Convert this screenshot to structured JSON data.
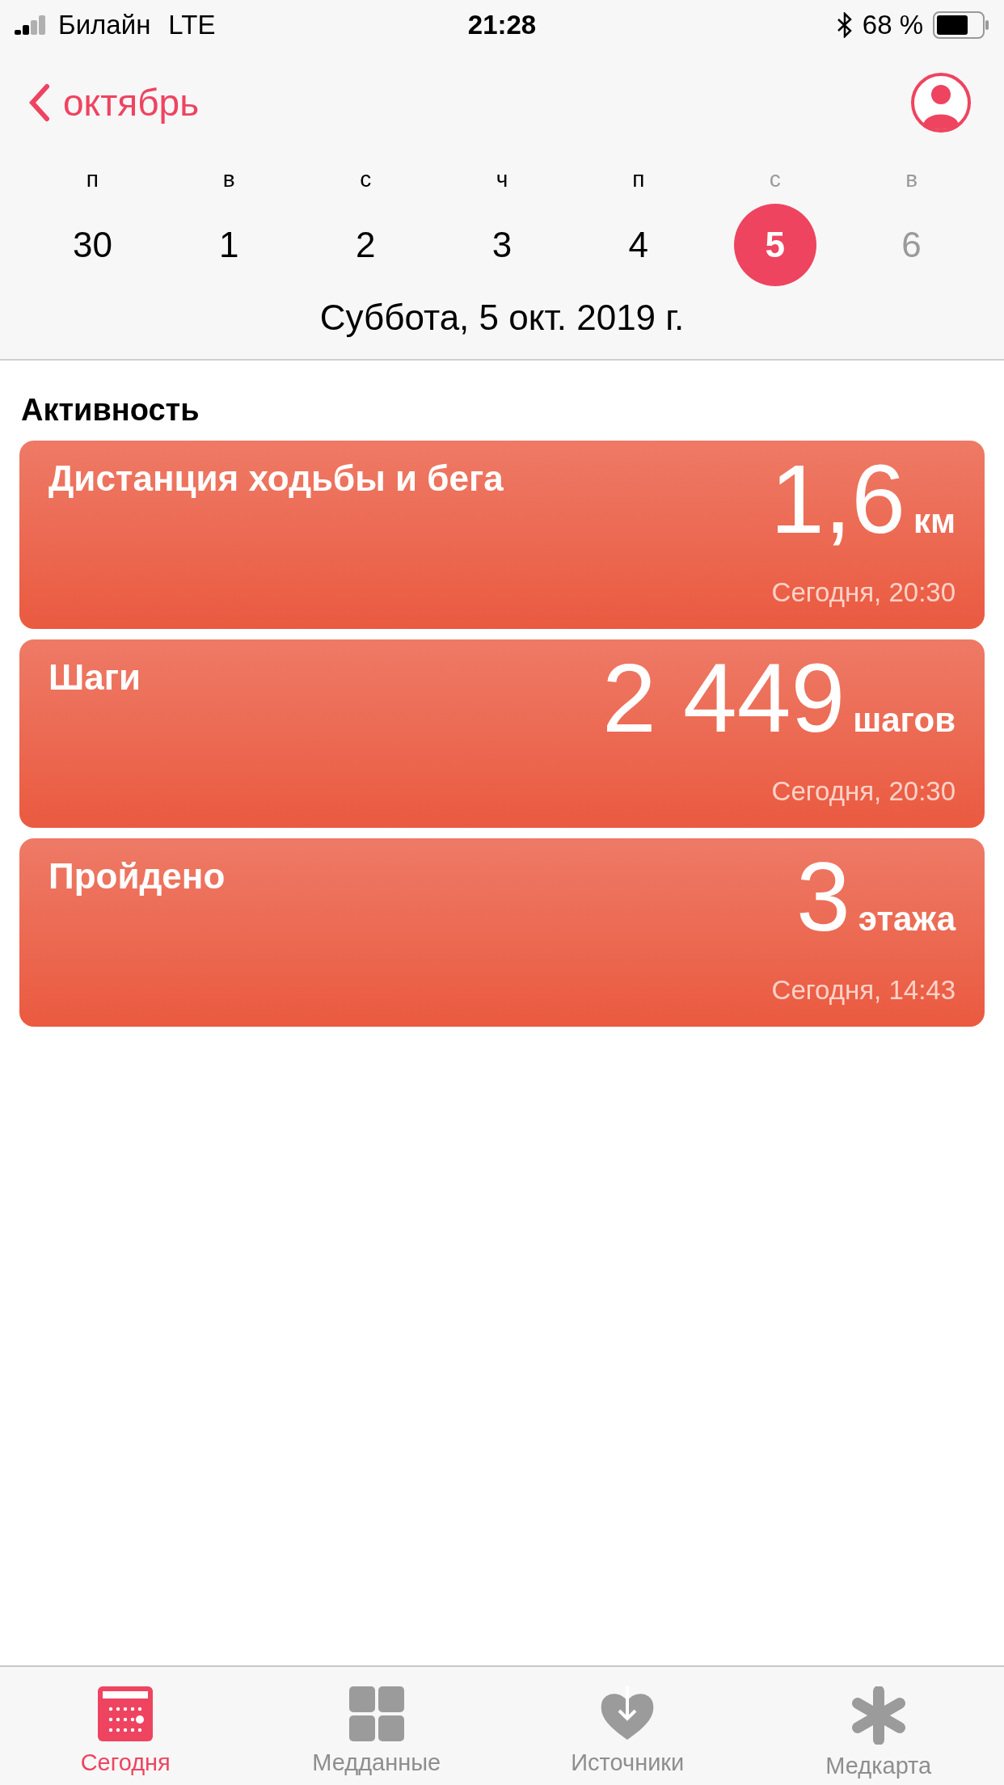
{
  "status_bar": {
    "carrier": "Билайн",
    "network": "LTE",
    "time": "21:28",
    "battery": "68 %"
  },
  "nav": {
    "back_label": "октябрь"
  },
  "week": [
    {
      "weekday": "п",
      "date": "30",
      "weekend": false,
      "future": false,
      "selected": false
    },
    {
      "weekday": "в",
      "date": "1",
      "weekend": false,
      "future": false,
      "selected": false
    },
    {
      "weekday": "с",
      "date": "2",
      "weekend": false,
      "future": false,
      "selected": false
    },
    {
      "weekday": "ч",
      "date": "3",
      "weekend": false,
      "future": false,
      "selected": false
    },
    {
      "weekday": "п",
      "date": "4",
      "weekend": false,
      "future": false,
      "selected": false
    },
    {
      "weekday": "с",
      "date": "5",
      "weekend": true,
      "future": false,
      "selected": true
    },
    {
      "weekday": "в",
      "date": "6",
      "weekend": true,
      "future": true,
      "selected": false
    }
  ],
  "selected_date": "Суббота, 5 окт. 2019 г.",
  "section_title": "Активность",
  "cards": [
    {
      "title": "Дистанция ходьбы и бега",
      "value": "1,6",
      "unit": "км",
      "time": "Сегодня, 20:30"
    },
    {
      "title": "Шаги",
      "value": "2 449",
      "unit": "шагов",
      "time": "Сегодня, 20:30"
    },
    {
      "title": "Пройдено",
      "value": "3",
      "unit": "этажа",
      "time": "Сегодня, 14:43"
    }
  ],
  "tab_bar": [
    {
      "kind": "today",
      "label": "Сегодня",
      "selected": true
    },
    {
      "kind": "data",
      "label": "Медданные",
      "selected": false
    },
    {
      "kind": "sources",
      "label": "Источники",
      "selected": false
    },
    {
      "kind": "medical",
      "label": "Медкарта",
      "selected": false
    }
  ]
}
